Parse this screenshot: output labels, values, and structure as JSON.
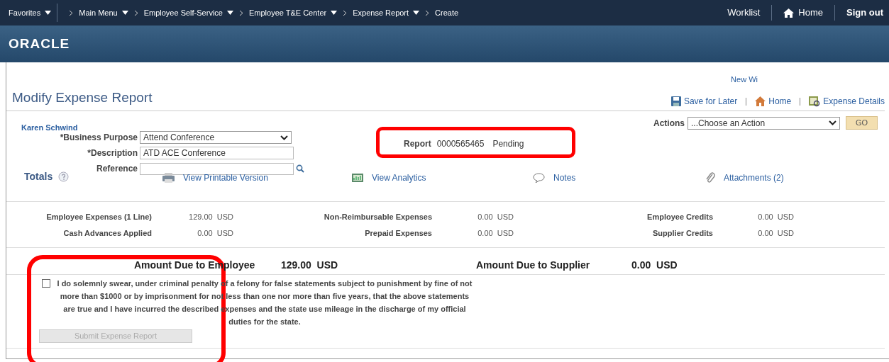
{
  "nav": {
    "items": [
      {
        "label": "Favorites",
        "dropdown": true
      },
      {
        "label": "Main Menu",
        "dropdown": true
      },
      {
        "label": "Employee Self-Service",
        "dropdown": true
      },
      {
        "label": "Employee T&E Center",
        "dropdown": true
      },
      {
        "label": "Expense Report",
        "dropdown": true
      },
      {
        "label": "Create",
        "dropdown": false
      }
    ],
    "right": [
      "Worklist",
      "Home",
      "Sign out"
    ]
  },
  "banner": {
    "logo": "ORACLE"
  },
  "new_window": "New Wi",
  "page_title": "Modify Expense Report",
  "page_links": [
    "Save for Later",
    "Home",
    "Expense Details"
  ],
  "employee": "Karen Schwind",
  "fields": [
    {
      "label": "*Business Purpose",
      "value": "Attend Conference",
      "kind": "select"
    },
    {
      "label": "*Description",
      "value": "ATD ACE Conference",
      "kind": "text"
    },
    {
      "label": "Reference",
      "kind": "lookup"
    }
  ],
  "report": {
    "label": "Report",
    "number": "0000565465",
    "status": "Pending"
  },
  "actions": {
    "label": "Actions",
    "value": "...Choose an Action",
    "button": "GO"
  },
  "totals": {
    "title": "Totals"
  },
  "tools": [
    {
      "label": "View Printable Version",
      "kind": "printer"
    },
    {
      "label": "View Analytics",
      "kind": "chart"
    },
    {
      "label": "Notes",
      "kind": "note"
    },
    {
      "label": "Attachments (2)",
      "kind": "clip"
    }
  ],
  "amounts": [
    [
      {
        "label": "Employee Expenses (1 Line)",
        "value": "129.00  USD"
      },
      {
        "label": "Non-Reimbursable Expenses",
        "value": "0.00  USD"
      },
      {
        "label": "Employee Credits",
        "value": "0.00  USD"
      }
    ],
    [
      {
        "label": "Cash Advances Applied",
        "value": "0.00  USD"
      },
      {
        "label": "Prepaid Expenses",
        "value": "0.00  USD"
      },
      {
        "label": "Supplier Credits",
        "value": "0.00  USD"
      }
    ]
  ],
  "due": [
    {
      "label": "Amount Due to Employee",
      "value": "129.00  USD"
    },
    {
      "label": "Amount Due to Supplier",
      "value": "0.00  USD"
    }
  ],
  "attestation": {
    "checked": false,
    "text": "I do solemnly swear, under criminal penalty of a felony for false statements subject to punishment by fine of not more than $1000 or by imprisonment for not less than one nor more than five years, that the above statements are true and I have incurred the described expenses and the state use mileage in the discharge of my official duties for the state."
  },
  "submit": {
    "label": "Submit Expense Report",
    "disabled": true
  }
}
